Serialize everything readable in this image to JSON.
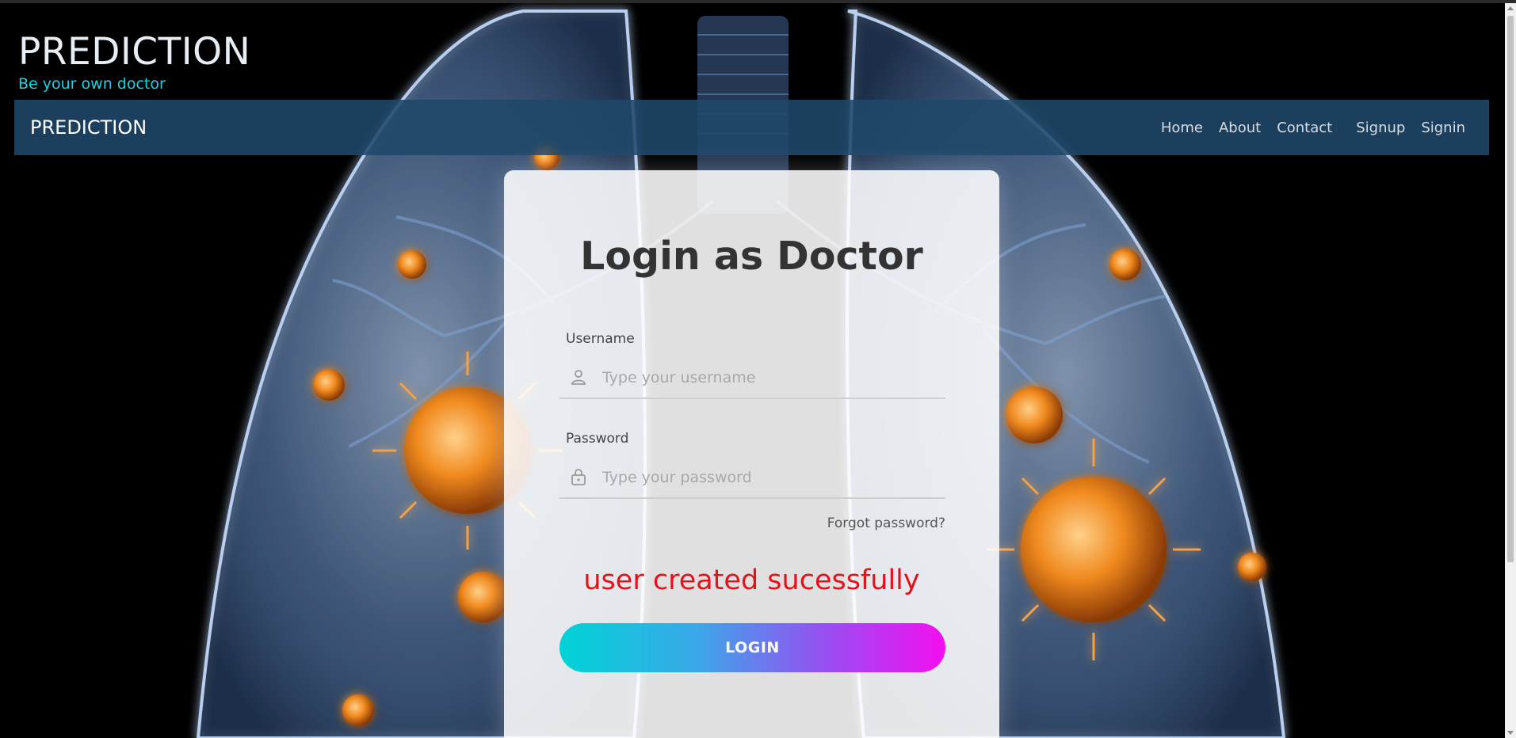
{
  "header": {
    "brand": "PREDICTION",
    "tagline": "Be your own doctor"
  },
  "navbar": {
    "brand": "PREDICTION",
    "links": [
      "Home",
      "About",
      "Contact",
      "Signup",
      "Signin"
    ]
  },
  "login": {
    "title": "Login as Doctor",
    "username_label": "Username",
    "username_placeholder": "Type your username",
    "username_icon": "user-icon",
    "password_label": "Password",
    "password_placeholder": "Type your password",
    "password_icon": "lock-icon",
    "forgot_password": "Forgot password?",
    "message": "user created sucessfully",
    "button_label": "LOGIN"
  },
  "colors": {
    "tagline": "#19d3e6",
    "navbar": "#1f486a",
    "message": "#e8101a",
    "button_gradient": [
      "#00d3d6",
      "#f40ef0"
    ]
  }
}
